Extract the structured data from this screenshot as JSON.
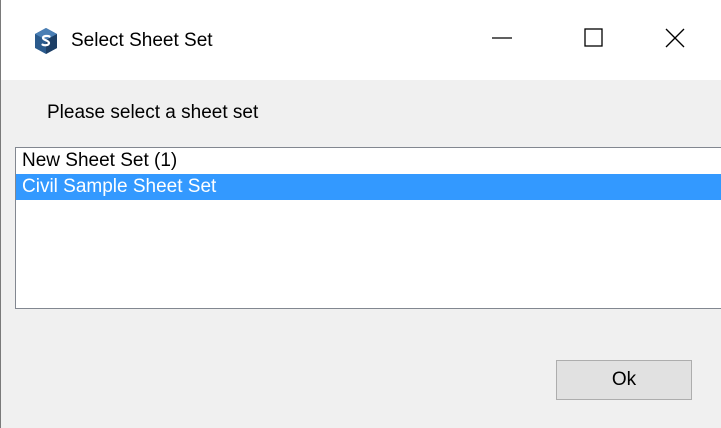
{
  "window": {
    "title": "Select Sheet Set",
    "icon": "sheet-set-app-icon",
    "controls": {
      "minimize_icon": "minimize-icon",
      "maximize_icon": "maximize-icon",
      "close_icon": "close-icon"
    }
  },
  "prompt": "Please select a sheet set",
  "sheet_sets": {
    "items": [
      {
        "label": "New Sheet Set (1)",
        "selected": false
      },
      {
        "label": "Civil Sample Sheet Set",
        "selected": true
      }
    ]
  },
  "ok_button": {
    "label": "Ok"
  },
  "colors": {
    "selection": "#3399ff",
    "titlebar": "#ffffff",
    "dialog_background": "#f0f0f0",
    "button_background": "#e1e1e1",
    "app_icon": "#2a5a8c"
  }
}
